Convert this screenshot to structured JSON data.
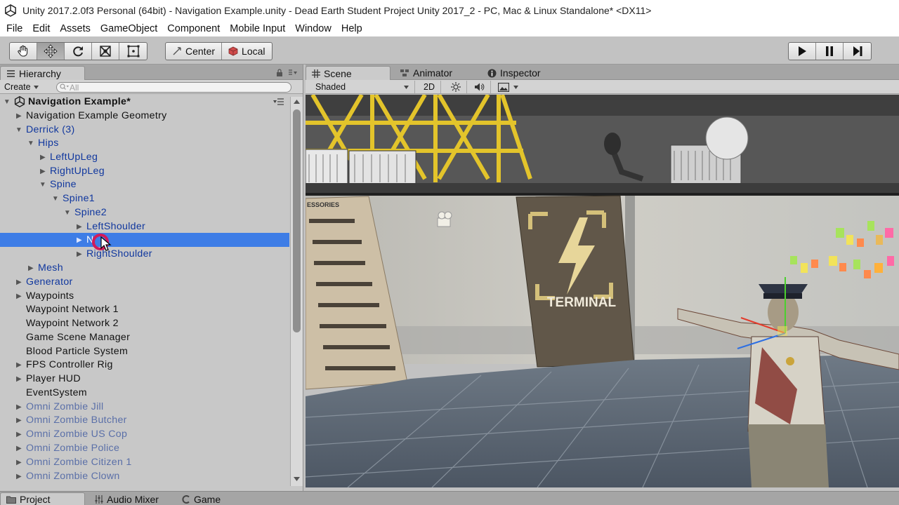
{
  "window": {
    "title": "Unity 2017.2.0f3 Personal (64bit) - Navigation Example.unity - Dead Earth Student Project Unity 2017_2 - PC, Mac & Linux Standalone* <DX11>"
  },
  "menu": [
    "File",
    "Edit",
    "Assets",
    "GameObject",
    "Component",
    "Mobile Input",
    "Window",
    "Help"
  ],
  "toolbar": {
    "pivot_label": "Center",
    "space_label": "Local"
  },
  "hierarchy": {
    "tab_label": "Hierarchy",
    "create_label": "Create",
    "search_placeholder": "All",
    "scene_name": "Navigation Example*",
    "rows": [
      {
        "label": "Navigation Example Geometry"
      },
      {
        "label": "Derrick (3)"
      },
      {
        "label": "Hips"
      },
      {
        "label": "LeftUpLeg"
      },
      {
        "label": "RightUpLeg"
      },
      {
        "label": "Spine"
      },
      {
        "label": "Spine1"
      },
      {
        "label": "Spine2"
      },
      {
        "label": "LeftShoulder"
      },
      {
        "label": "N"
      },
      {
        "label": "RightShoulder"
      },
      {
        "label": "Mesh"
      },
      {
        "label": "Generator"
      },
      {
        "label": "Waypoints"
      },
      {
        "label": "Waypoint Network 1"
      },
      {
        "label": "Waypoint Network 2"
      },
      {
        "label": "Game Scene Manager"
      },
      {
        "label": "Blood Particle System"
      },
      {
        "label": "FPS Controller Rig"
      },
      {
        "label": "Player HUD"
      },
      {
        "label": "EventSystem"
      },
      {
        "label": "Omni Zombie Jill"
      },
      {
        "label": "Omni Zombie Butcher"
      },
      {
        "label": "Omni Zombie US Cop"
      },
      {
        "label": "Omni Zombie Police"
      },
      {
        "label": "Omni Zombie Citizen 1"
      },
      {
        "label": "Omni Zombie Clown"
      }
    ]
  },
  "scene": {
    "tabs": [
      "Scene",
      "Animator",
      "Inspector"
    ],
    "shading_mode": "Shaded",
    "mode_2d": "2D",
    "poster_text": "TERMINAL",
    "accessories_text": "ESSORIES"
  },
  "bottom_tabs": [
    "Project",
    "Audio Mixer",
    "Game"
  ],
  "colors": {
    "selection": "#3e7de6",
    "prefab_text": "#10379e",
    "cursor_ring": "#d21b5a"
  }
}
